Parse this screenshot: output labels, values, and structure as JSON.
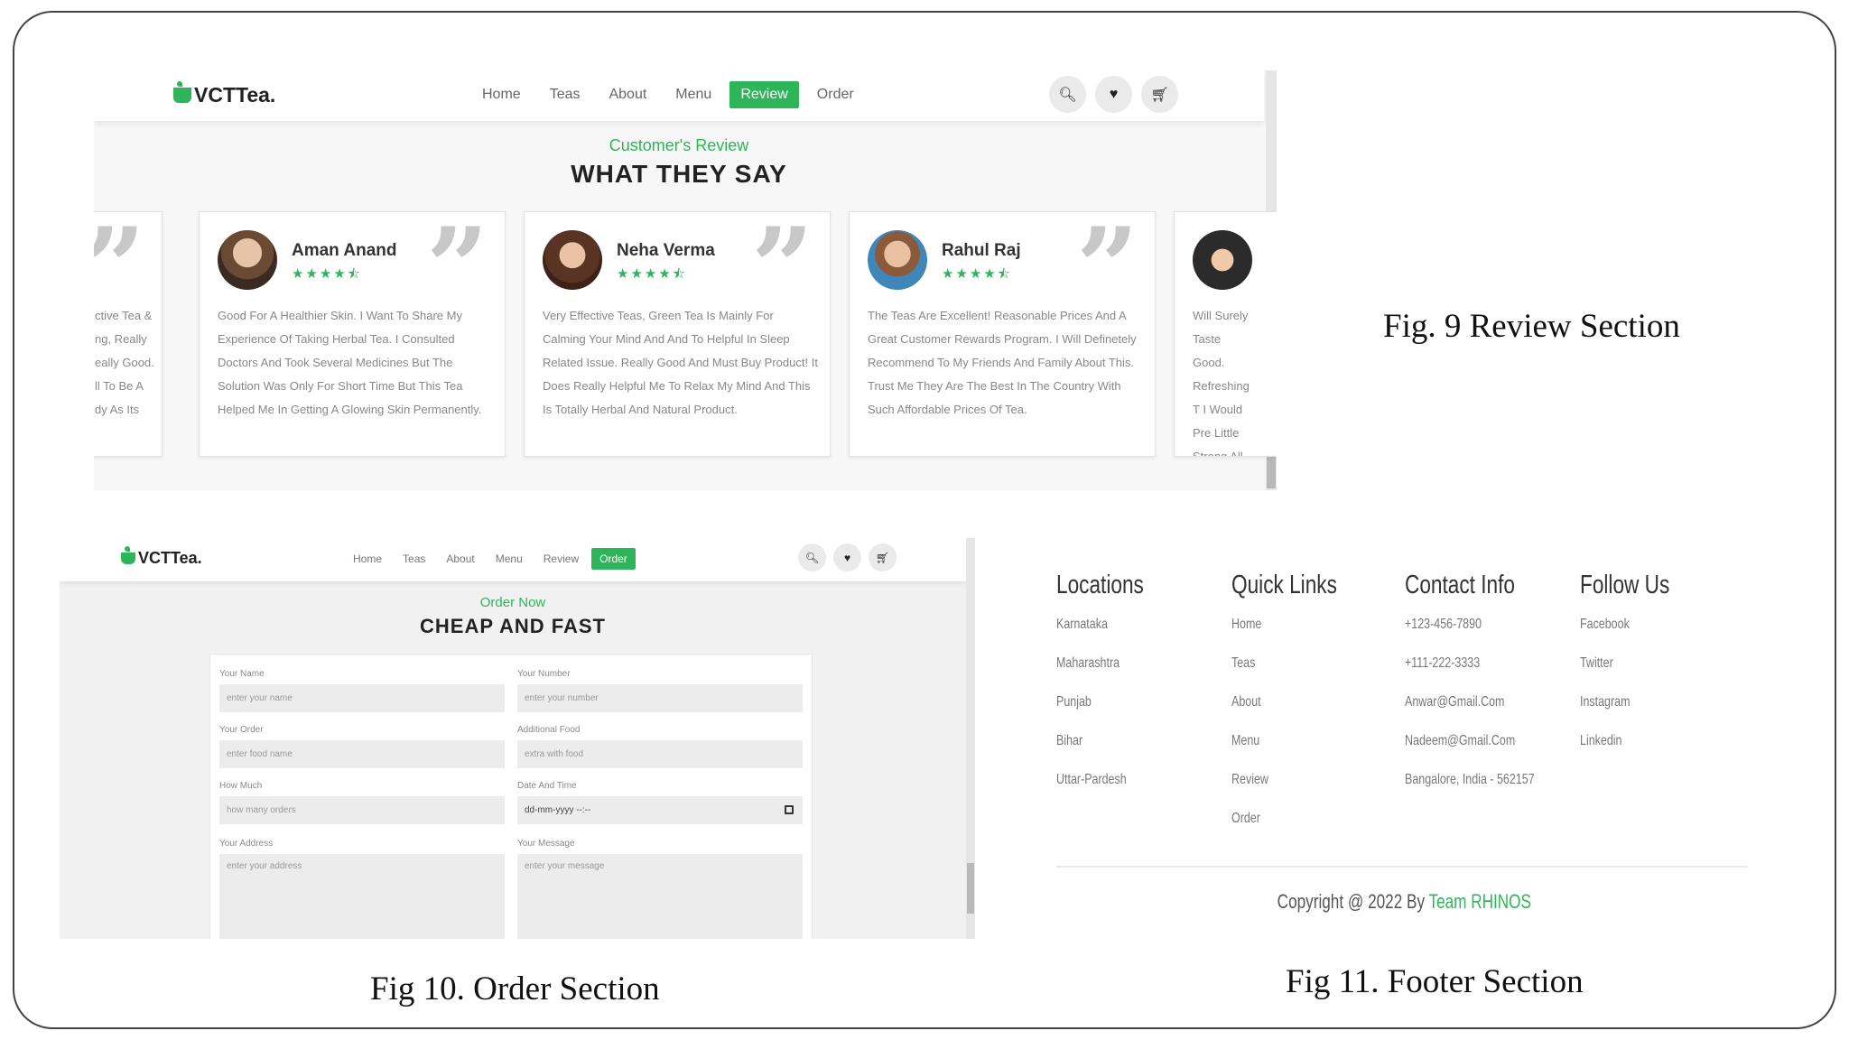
{
  "captions": {
    "fig9": "Fig. 9 Review Section",
    "fig10": "Fig 10. Order Section",
    "fig11": "Fig 11. Footer Section"
  },
  "review_page": {
    "logo": "VCTTea.",
    "nav": [
      "Home",
      "Teas",
      "About",
      "Menu",
      "Review",
      "Order"
    ],
    "active_nav": "Review",
    "icons": [
      "search-icon",
      "heart-icon",
      "cart-icon"
    ],
    "subtitle": "Customer's Review",
    "title": "WHAT THEY SAY",
    "reviews": [
      {
        "name": "",
        "text": "ctive Tea & ng, Really eally Good. ll To Be A dy As Its"
      },
      {
        "name": "Aman Anand",
        "stars": "★★★★⯪",
        "text": "Good For A Healthier Skin. I Want To Share My Experience Of Taking Herbal Tea. I Consulted Doctors And Took Several Medicines But The Solution Was Only For Short Time But This Tea Helped Me In Getting A Glowing Skin Permanently."
      },
      {
        "name": "Neha Verma",
        "stars": "★★★★⯪",
        "text": "Very Effective Teas, Green Tea Is Mainly For Calming Your Mind And And To Helpful In Sleep Related Issue. Really Good And Must Buy Product! It Does Really Helpful Me To Relax My Mind And This Is Totally Herbal And Natural Product."
      },
      {
        "name": "Rahul Raj",
        "stars": "★★★★⯪",
        "text": "The Teas Are Excellent! Reasonable Prices And A Great Customer Rewards Program. I Will Definetely Recommend To My Friends And Family About This. Trust Me They Are The Best In The Country With Such Affordable Prices Of Tea."
      },
      {
        "name": "",
        "text": "Will Surely Taste Good. Refreshing T I Would Pre Little Strong All Organic"
      }
    ]
  },
  "order_page": {
    "logo": "VCTTea.",
    "nav": [
      "Home",
      "Teas",
      "About",
      "Menu",
      "Review",
      "Order"
    ],
    "active_nav": "Order",
    "subtitle": "Order Now",
    "title": "CHEAP AND FAST",
    "fields": {
      "name_label": "Your Name",
      "name_placeholder": "enter your name",
      "number_label": "Your Number",
      "number_placeholder": "enter your number",
      "order_label": "Your Order",
      "order_placeholder": "enter food name",
      "additional_label": "Additional Food",
      "additional_placeholder": "extra with food",
      "howmuch_label": "How Much",
      "howmuch_placeholder": "how many orders",
      "datetime_label": "Date And Time",
      "datetime_placeholder": "dd-mm-yyyy --:--",
      "address_label": "Your Address",
      "address_placeholder": "enter your address",
      "message_label": "Your Message",
      "message_placeholder": "enter your message"
    }
  },
  "footer": {
    "columns": [
      {
        "heading": "Locations",
        "links": [
          "Karnataka",
          "Maharashtra",
          "Punjab",
          "Bihar",
          "Uttar-Pardesh"
        ]
      },
      {
        "heading": "Quick Links",
        "links": [
          "Home",
          "Teas",
          "About",
          "Menu",
          "Review",
          "Order"
        ]
      },
      {
        "heading": "Contact Info",
        "links": [
          "+123-456-7890",
          "+111-222-3333",
          "Anwar@Gmail.Com",
          "Nadeem@Gmail.Com",
          "Bangalore, India - 562157"
        ]
      },
      {
        "heading": "Follow Us",
        "links": [
          "Facebook",
          "Twitter",
          "Instagram",
          "Linkedin"
        ]
      }
    ],
    "copyright": "Copyright @ 2022 By ",
    "copyright_brand": "Team RHINOS"
  },
  "colors": {
    "accent": "#2eb55a"
  }
}
